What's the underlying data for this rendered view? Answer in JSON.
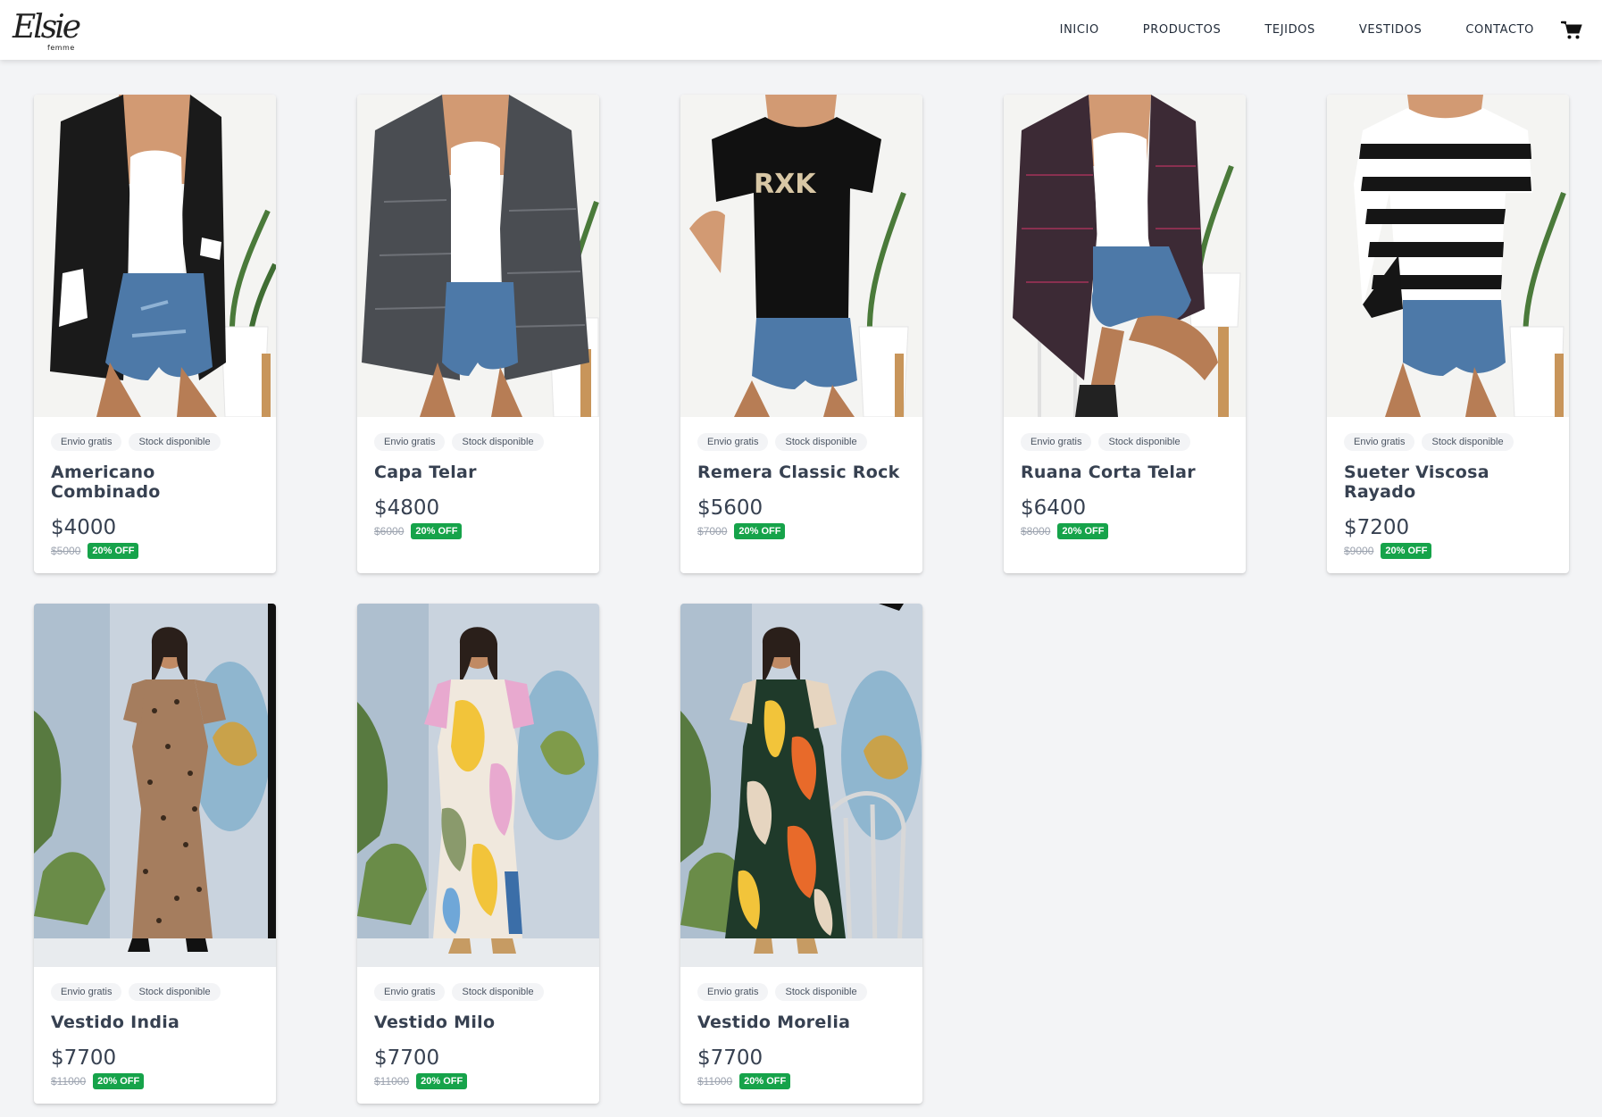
{
  "brand": {
    "logo_text": "Elsie",
    "logo_sub": "femme"
  },
  "nav": {
    "items": [
      "INICIO",
      "PRODUCTOS",
      "TEJIDOS",
      "VESTIDOS",
      "CONTACTO"
    ],
    "cart_icon": "shopping-cart-icon"
  },
  "tags": {
    "shipping": "Envio gratis",
    "stock": "Stock disponible"
  },
  "colors": {
    "badge": "#16a34a",
    "background": "#f3f4f6"
  },
  "products": [
    {
      "name": "Americano Combinado",
      "price": "$4000",
      "old_price": "$5000",
      "discount": "20% OFF"
    },
    {
      "name": "Capa Telar",
      "price": "$4800",
      "old_price": "$6000",
      "discount": "20% OFF"
    },
    {
      "name": "Remera Classic Rock",
      "price": "$5600",
      "old_price": "$7000",
      "discount": "20% OFF"
    },
    {
      "name": "Ruana Corta Telar",
      "price": "$6400",
      "old_price": "$8000",
      "discount": "20% OFF"
    },
    {
      "name": "Sueter Viscosa Rayado",
      "price": "$7200",
      "old_price": "$9000",
      "discount": "20% OFF"
    },
    {
      "name": "Vestido India",
      "price": "$7700",
      "old_price": "$11000",
      "discount": "20% OFF"
    },
    {
      "name": "Vestido Milo",
      "price": "$7700",
      "old_price": "$11000",
      "discount": "20% OFF"
    },
    {
      "name": "Vestido Morelia",
      "price": "$7700",
      "old_price": "$11000",
      "discount": "20% OFF"
    }
  ]
}
